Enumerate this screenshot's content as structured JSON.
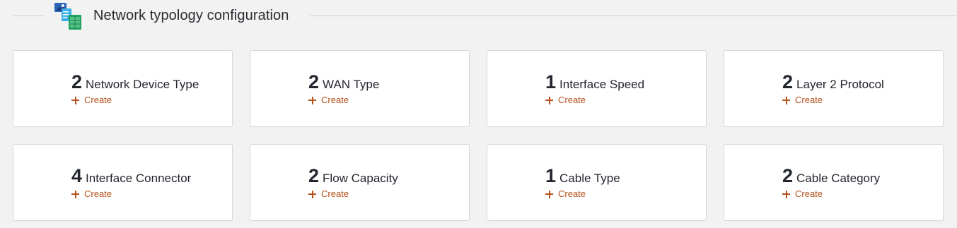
{
  "section": {
    "title": "Network typology configuration",
    "icon": "network-config-icon"
  },
  "colors": {
    "background": "#f2f2f2",
    "card": "#ffffff",
    "text": "#23262f",
    "accent": "#b5501d"
  },
  "cards": [
    {
      "count": "2",
      "label": "Network Device Type",
      "action": "Create"
    },
    {
      "count": "2",
      "label": "WAN Type",
      "action": "Create"
    },
    {
      "count": "1",
      "label": "Interface Speed",
      "action": "Create"
    },
    {
      "count": "2",
      "label": "Layer 2 Protocol",
      "action": "Create"
    },
    {
      "count": "4",
      "label": "Interface Connector",
      "action": "Create"
    },
    {
      "count": "2",
      "label": "Flow Capacity",
      "action": "Create"
    },
    {
      "count": "1",
      "label": "Cable Type",
      "action": "Create"
    },
    {
      "count": "2",
      "label": "Cable Category",
      "action": "Create"
    }
  ]
}
